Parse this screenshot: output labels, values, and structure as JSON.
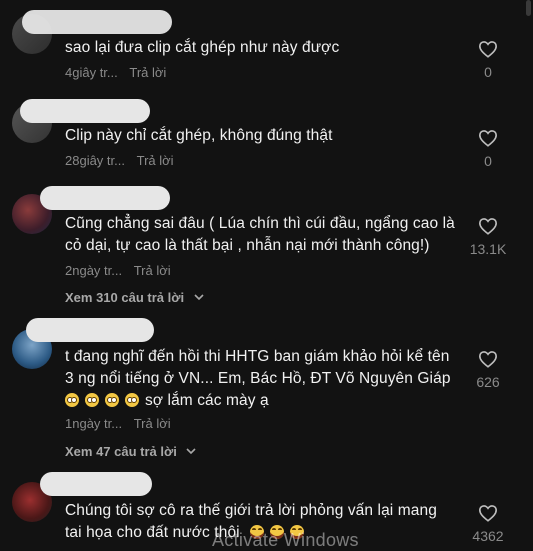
{
  "comments": [
    {
      "text": "sao lại đưa clip cắt ghép như này được",
      "time": "4giây tr...",
      "reply_label": "Trả lời",
      "likes": "0"
    },
    {
      "text": "Clip này chỉ cắt ghép, không đúng thật",
      "time": "28giây tr...",
      "reply_label": "Trả lời",
      "likes": "0"
    },
    {
      "text": "Cũng chẳng sai đâu ( Lúa chín thì cúi đầu, ngẩng cao là cỏ dại, tự cao là thất bại , nhẫn nại mới thành công!)",
      "time": "2ngày tr...",
      "reply_label": "Trả lời",
      "likes": "13.1K",
      "view_replies": "Xem 310 câu trả lời"
    },
    {
      "text_line1": "t đang nghĩ đến hồi thi HHTG ban giám khảo hỏi kể tên",
      "text_line2": "3 ng nổi tiếng ở VN... Em, Bác Hồ, ĐT Võ Nguyên Giáp",
      "text_line3": "sợ lắm các mày ạ",
      "time": "1ngày tr...",
      "reply_label": "Trả lời",
      "likes": "626",
      "view_replies": "Xem 47 câu trả lời"
    },
    {
      "text_line1": "Chúng tôi sợ cô ra thế giới trả lời phỏng vấn lại mang",
      "text_line2": "tai họa cho đất nước thôi",
      "likes": "4362"
    }
  ],
  "icons": {
    "like": "heart-outline-icon",
    "expand": "chevron-down-icon",
    "emoji_flushed": "flushed-face-emoji",
    "emoji_joy": "tears-of-joy-emoji"
  },
  "watermark": "Activate Windows",
  "colors": {
    "background": "#121212",
    "text": "#f1f1f1",
    "muted": "#8a8a8a"
  }
}
